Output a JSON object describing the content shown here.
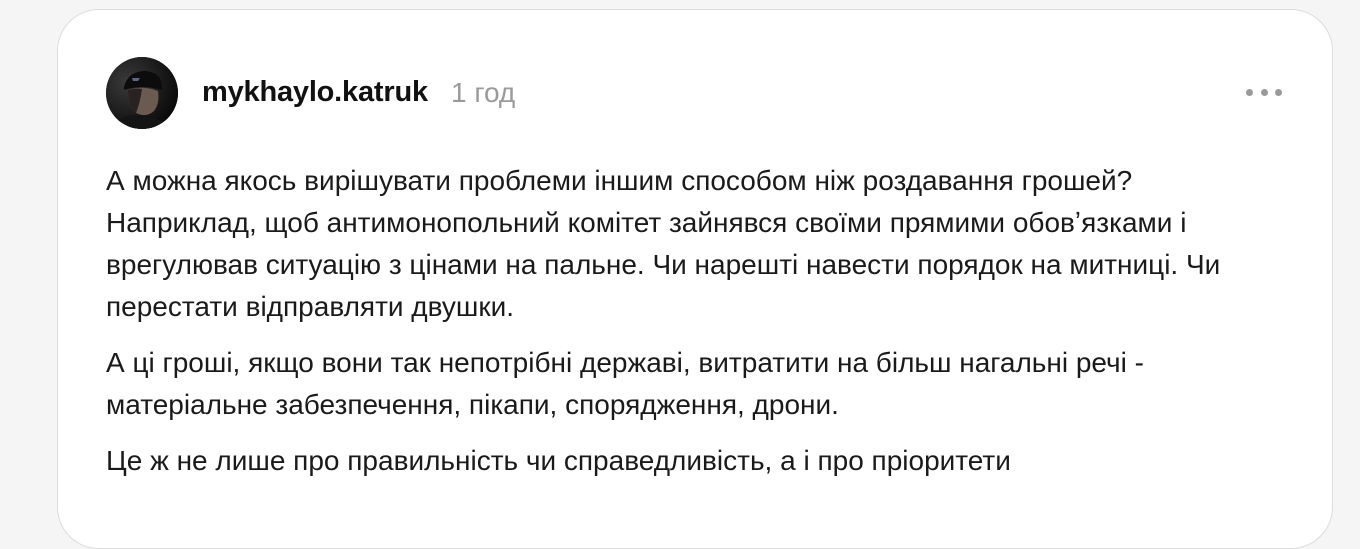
{
  "post": {
    "author": {
      "username": "mykhaylo.katruk",
      "avatar_icon": "user-avatar-photo"
    },
    "timestamp": "1 год",
    "more_icon": "more-horizontal-icon",
    "paragraphs": [
      "А можна якось вирішувати проблеми іншим способом ніж роздавання грошей? Наприклад, щоб антимонопольний комітет зайнявся своїми прямими обовʼязками і врегулював ситуацію з цінами на пальне. Чи нарешті навести порядок на митниці. Чи перестати відправляти двушки.",
      "А ці гроші, якщо вони так непотрібні державі, витратити на більш нагальні речі - матеріальне забезпечення, пікапи, спорядження, дрони.",
      "Це ж не лише про правильність чи справедливість, а і про пріоритети"
    ]
  },
  "colors": {
    "background": "#f5f5f5",
    "card": "#ffffff",
    "text": "#1a1a1a",
    "muted": "#9a9a9a"
  }
}
